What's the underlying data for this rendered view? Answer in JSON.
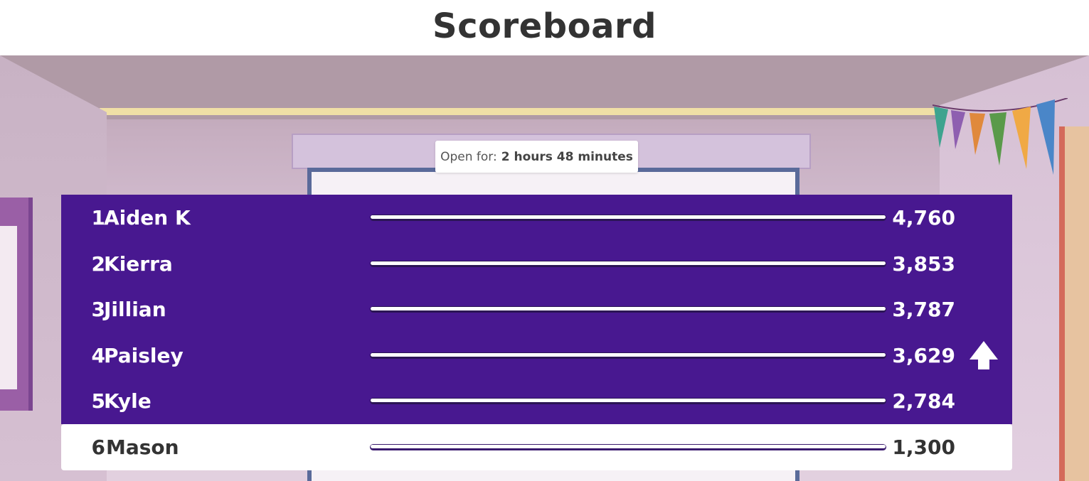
{
  "title": "Scoreboard",
  "status": {
    "label": "Open for:",
    "value": "2 hours 48 minutes"
  },
  "colors": {
    "row_background": "#481890",
    "highlight_row_background": "#ffffff",
    "title_text": "#333333"
  },
  "leaderboard": [
    {
      "rank": "1",
      "name": "Aiden K",
      "score": "4,760",
      "progress": 1.0,
      "trend": ""
    },
    {
      "rank": "2",
      "name": "Kierra",
      "score": "3,853",
      "progress": 1.0,
      "trend": ""
    },
    {
      "rank": "3",
      "name": "Jillian",
      "score": "3,787",
      "progress": 1.0,
      "trend": ""
    },
    {
      "rank": "4",
      "name": "Paisley",
      "score": "3,629",
      "progress": 1.0,
      "trend": "up-arrow-icon"
    },
    {
      "rank": "5",
      "name": "Kyle",
      "score": "2,784",
      "progress": 1.0,
      "trend": ""
    },
    {
      "rank": "6",
      "name": "Mason",
      "score": "1,300",
      "progress": 1.0,
      "trend": "",
      "current_user": true
    }
  ]
}
